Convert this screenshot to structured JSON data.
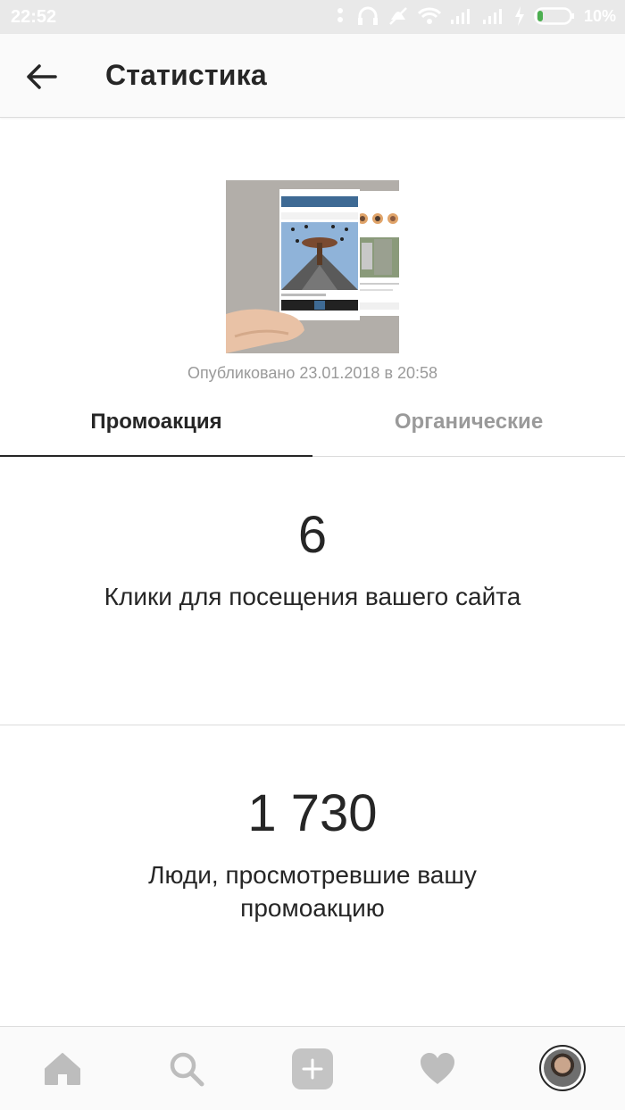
{
  "status_bar": {
    "time": "22:52",
    "battery_percent": "10%",
    "icons": [
      "alarm-icon",
      "headphones-icon",
      "mute-icon",
      "wifi-icon",
      "signal-icon",
      "signal-icon",
      "charging-icon",
      "battery-icon"
    ]
  },
  "header": {
    "back_icon": "arrow-left-icon",
    "title": "Статистика"
  },
  "post": {
    "published": "Опубликовано 23.01.2018 в 20:58"
  },
  "tabs": [
    {
      "label": "Промоакция",
      "active": true
    },
    {
      "label": "Органические",
      "active": false
    }
  ],
  "metrics": [
    {
      "value": "6",
      "label": "Клики для посещения вашего сайта"
    },
    {
      "value": "1 730",
      "label": "Люди, просмотревшие вашу промоакцию"
    }
  ],
  "bottom_nav": {
    "items": [
      "home-icon",
      "search-icon",
      "add-icon",
      "heart-icon",
      "profile-avatar"
    ]
  },
  "colors": {
    "text_primary": "#262626",
    "text_secondary": "#9a9a9a",
    "divider": "#dcdcdc",
    "icon_gray": "#bdbdbd",
    "battery_level": "#4caf50"
  }
}
